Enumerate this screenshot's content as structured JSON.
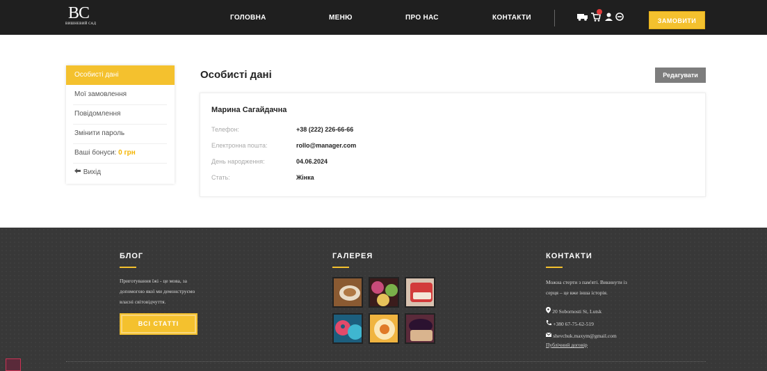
{
  "header": {
    "logo_mono": "BC",
    "logo_sub": "ВИШНЕВИЙ САД",
    "nav": [
      "ГОЛОВНА",
      "МЕНЮ",
      "ПРО НАС",
      "КОНТАКТИ"
    ],
    "order_label": "ЗАМОВИТИ",
    "icons": [
      "truck-icon",
      "cart-icon",
      "user-icon",
      "exit-icon"
    ]
  },
  "sidebar": {
    "items": [
      "Особисті дані",
      "Мої замовлення",
      "Повідомлення",
      "Змінити пароль",
      "Ваші бонуси:",
      "Вихід"
    ],
    "bonus_value": "0 грн"
  },
  "profile": {
    "title": "Особисті дані",
    "edit_label": "Редагувати",
    "name": "Марина Сагайдачна",
    "fields": [
      {
        "label": "Телефон:",
        "value": "+38 (222) 226-66-66"
      },
      {
        "label": "Електронна пошта:",
        "value": "rollo@manager.com"
      },
      {
        "label": "День народження:",
        "value": "04.06.2024"
      },
      {
        "label": "Стать:",
        "value": "Жінка"
      }
    ]
  },
  "footer": {
    "blog": {
      "title": "БЛОГ",
      "lines": [
        "Приготування їжі - це мова, за",
        "допомогою якої ми демонструємо",
        "власні світовідчуття."
      ],
      "button": "ВСІ СТАТТІ"
    },
    "gallery": {
      "title": "ГАЛЕРЕЯ"
    },
    "contacts": {
      "title": "КОНТАКТИ",
      "lines": [
        "Можна стерти з пам'яті. Викинути із",
        "серця – це вже інша історія."
      ],
      "address": "20 Sobornosti St, Lutsk",
      "phone": "+380 67-75-62-519",
      "email": "shevchuk.maxym@gmail.com",
      "contract": "Публічний договір"
    }
  },
  "colors": {
    "accent": "#f4c12e",
    "header_bg": "#1f1f1f",
    "footer_bg": "#383838"
  }
}
